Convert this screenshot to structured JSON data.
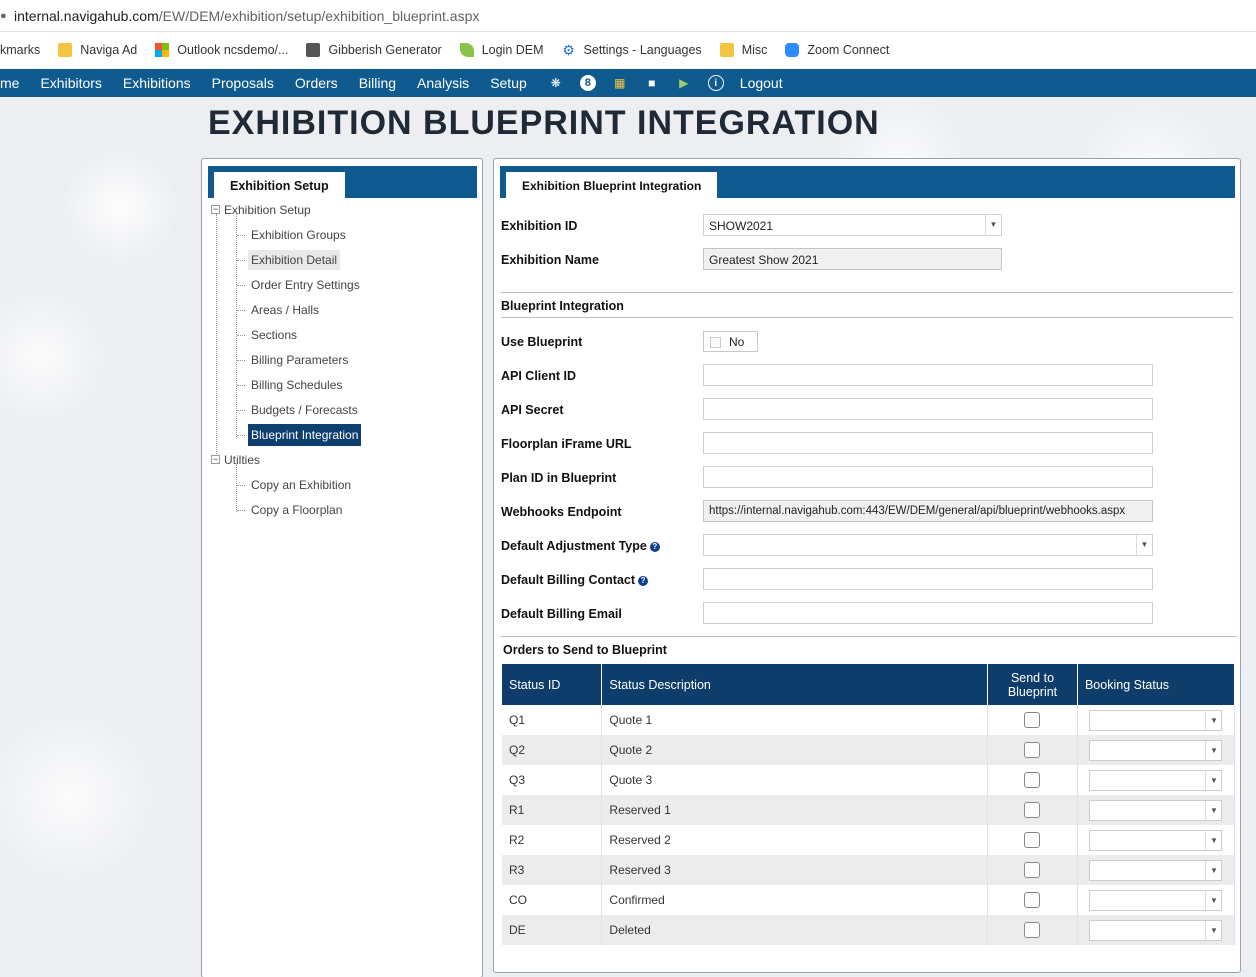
{
  "browser": {
    "url_host": "internal.navigahub.com",
    "url_path": "/EW/DEM/exhibition/setup/exhibition_blueprint.aspx",
    "bookmarks": [
      {
        "label": "kmarks",
        "icon": "none"
      },
      {
        "label": "Naviga Ad",
        "icon": "folder-icon"
      },
      {
        "label": "Outlook ncsdemo/...",
        "icon": "microsoft-icon"
      },
      {
        "label": "Gibberish Generator",
        "icon": "generator-icon"
      },
      {
        "label": "Login DEM",
        "icon": "leaf-icon"
      },
      {
        "label": "Settings - Languages",
        "icon": "gear-icon"
      },
      {
        "label": "Misc",
        "icon": "folder-icon"
      },
      {
        "label": "Zoom Connect",
        "icon": "zoom-icon"
      }
    ]
  },
  "nav": {
    "items": [
      "me",
      "Exhibitors",
      "Exhibitions",
      "Proposals",
      "Orders",
      "Billing",
      "Analysis",
      "Setup"
    ],
    "badge": "8",
    "logout": "Logout"
  },
  "page": {
    "title": "EXHIBITION BLUEPRINT INTEGRATION"
  },
  "left": {
    "tab": "Exhibition Setup",
    "tree": {
      "root1": "Exhibition Setup",
      "root1_children": [
        "Exhibition Groups",
        "Exhibition Detail",
        "Order Entry Settings",
        "Areas / Halls",
        "Sections",
        "Billing Parameters",
        "Billing Schedules",
        "Budgets / Forecasts",
        "Blueprint Integration"
      ],
      "root2": "Utilties",
      "root2_children": [
        "Copy an Exhibition",
        "Copy a Floorplan"
      ]
    }
  },
  "right": {
    "tab": "Exhibition Blueprint Integration",
    "exhibition_id_label": "Exhibition ID",
    "exhibition_id_value": "SHOW2021",
    "exhibition_name_label": "Exhibition Name",
    "exhibition_name_value": "Greatest Show 2021",
    "section_blueprint": "Blueprint Integration",
    "use_blueprint_label": "Use Blueprint",
    "use_blueprint_value": "No",
    "api_client_id_label": "API Client ID",
    "api_secret_label": "API Secret",
    "floorplan_url_label": "Floorplan iFrame URL",
    "plan_id_label": "Plan ID in Blueprint",
    "webhooks_label": "Webhooks Endpoint",
    "webhooks_value": "https://internal.navigahub.com:443/EW/DEM/general/api/blueprint/webhooks.aspx",
    "adjustment_type_label": "Default Adjustment Type",
    "billing_contact_label": "Default Billing Contact",
    "billing_email_label": "Default Billing Email",
    "section_orders": "Orders to Send to Blueprint",
    "table": {
      "headers": [
        "Status ID",
        "Status Description",
        "Send to Blueprint",
        "Booking Status"
      ],
      "rows": [
        {
          "id": "Q1",
          "desc": "Quote 1"
        },
        {
          "id": "Q2",
          "desc": "Quote 2"
        },
        {
          "id": "Q3",
          "desc": "Quote 3"
        },
        {
          "id": "R1",
          "desc": "Reserved 1"
        },
        {
          "id": "R2",
          "desc": "Reserved 2"
        },
        {
          "id": "R3",
          "desc": "Reserved 3"
        },
        {
          "id": "CO",
          "desc": "Confirmed"
        },
        {
          "id": "DE",
          "desc": "Deleted"
        }
      ]
    }
  }
}
